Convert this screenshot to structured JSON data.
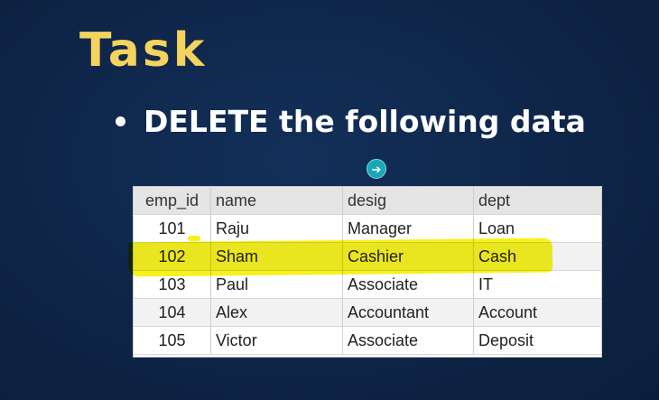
{
  "slide": {
    "title": "Task",
    "bullet": "DELETE the following data"
  },
  "colors": {
    "background": "#0f2749",
    "title": "#f4d35e",
    "bullet_text": "#ffffff",
    "highlight": "#f5f000",
    "cursor": "#19a7b5"
  },
  "cursor_icon": "arrow-right-circle-icon",
  "table": {
    "columns": [
      "emp_id",
      "name",
      "desig",
      "dept"
    ],
    "rows": [
      {
        "emp_id": "101",
        "name": "Raju",
        "desig": "Manager",
        "dept": "Loan"
      },
      {
        "emp_id": "102",
        "name": "Sham",
        "desig": "Cashier",
        "dept": "Cash"
      },
      {
        "emp_id": "103",
        "name": "Paul",
        "desig": "Associate",
        "dept": "IT"
      },
      {
        "emp_id": "104",
        "name": "Alex",
        "desig": "Accountant",
        "dept": "Account"
      },
      {
        "emp_id": "105",
        "name": "Victor",
        "desig": "Associate",
        "dept": "Deposit"
      }
    ],
    "highlighted_emp_id": "102"
  }
}
